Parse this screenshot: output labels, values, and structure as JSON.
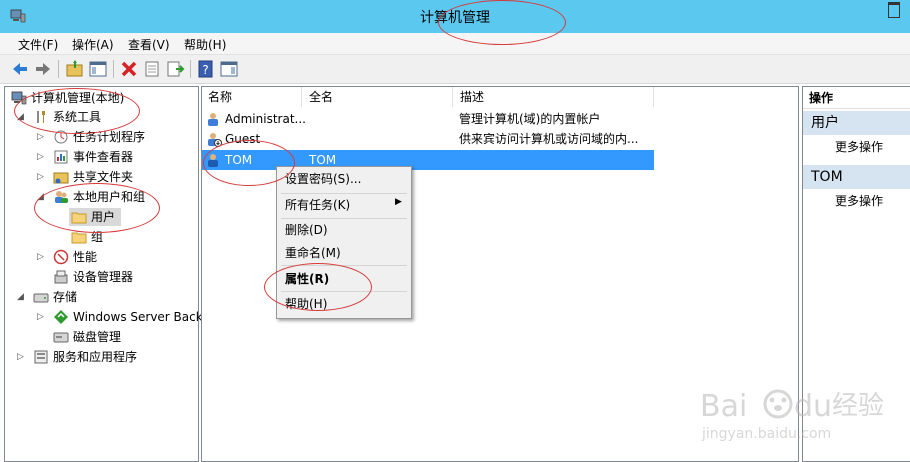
{
  "window": {
    "title": "计算机管理"
  },
  "menu": [
    "文件(F)",
    "操作(A)",
    "查看(V)",
    "帮助(H)"
  ],
  "tree": {
    "root": "计算机管理(本地)",
    "system_tools": "系统工具",
    "task_scheduler": "任务计划程序",
    "event_viewer": "事件查看器",
    "shared_folders": "共享文件夹",
    "local_users_groups": "本地用户和组",
    "users": "用户",
    "groups": "组",
    "performance": "性能",
    "device_manager": "设备管理器",
    "storage": "存储",
    "windows_backup": "Windows Server Back",
    "disk_management": "磁盘管理",
    "services_apps": "服务和应用程序"
  },
  "list": {
    "columns": [
      "名称",
      "全名",
      "描述"
    ],
    "rows": [
      {
        "name": "Administrat...",
        "fullname": "",
        "desc": "管理计算机(域)的内置帐户"
      },
      {
        "name": "Guest",
        "fullname": "",
        "desc": "供来宾访问计算机或访问域的内..."
      },
      {
        "name": "TOM",
        "fullname": "TOM",
        "desc": ""
      }
    ]
  },
  "context_menu": {
    "set_password": "设置密码(S)...",
    "all_tasks": "所有任务(K)",
    "delete": "删除(D)",
    "rename": "重命名(M)",
    "properties": "属性(R)",
    "help": "帮助(H)"
  },
  "actions": {
    "header": "操作",
    "section1": "用户",
    "more1": "更多操作",
    "section2": "TOM",
    "more2": "更多操作"
  },
  "watermark": {
    "brand": "Bai",
    "brand2": "du",
    "site": "经验",
    "url": "jingyan.baidu.com"
  },
  "colors": {
    "titlebar": "#5bc8ef",
    "selection": "#3399ff",
    "annotation": "#d63a3a",
    "action_section": "#d6e4f2"
  }
}
